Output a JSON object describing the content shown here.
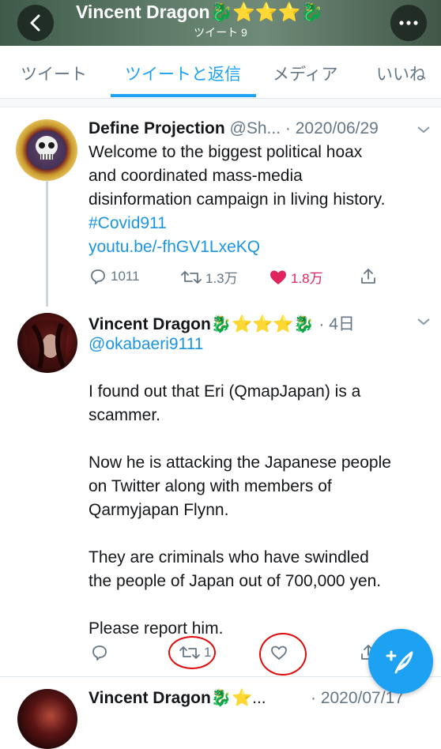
{
  "header": {
    "name": "Vincent Dragon",
    "name_emoji": "🐉⭐⭐⭐🐉",
    "tweet_count": "ツイート 9",
    "back_icon": "chevron-left-icon",
    "more_icon": "more-icon"
  },
  "tabs": [
    {
      "label": "ツイート"
    },
    {
      "label": "ツイートと返信"
    },
    {
      "label": "メディア"
    },
    {
      "label": "いいね"
    }
  ],
  "tweets": [
    {
      "display_name": "Define Projection",
      "handle": "@Sh...",
      "date": "· 2020/06/29",
      "lines": [
        "Welcome to the biggest political hoax",
        "and coordinated mass-media",
        "disinformation campaign in living history."
      ],
      "hashtag": "#Covid911",
      "url": "youtu.be/-fhGV1LxeKQ",
      "replies": "1011",
      "retweets": "1.3万",
      "likes": "1.8万"
    },
    {
      "display_name": "Vincent Dragon",
      "name_emoji": "🐉⭐⭐⭐🐉",
      "date": "· 4日",
      "handle": "@okabaeri9111",
      "paragraphs": [
        [
          "I found out that Eri (QmapJapan) is a",
          "scammer."
        ],
        [
          "Now he is attacking the Japanese people",
          "on Twitter along with members of",
          "Qarmyjapan Flynn."
        ],
        [
          "They are criminals who have swindled",
          "the people of Japan out of 700,000 yen."
        ],
        [
          "Please report him."
        ]
      ],
      "retweets": "1"
    },
    {
      "display_name": "Vincent Dragon",
      "name_emoji": "🐉⭐...",
      "date": "· 2020/07/17"
    }
  ],
  "colors": {
    "accent": "#1da1f2",
    "like": "#e0245e",
    "annotation": "#e00b0b"
  }
}
